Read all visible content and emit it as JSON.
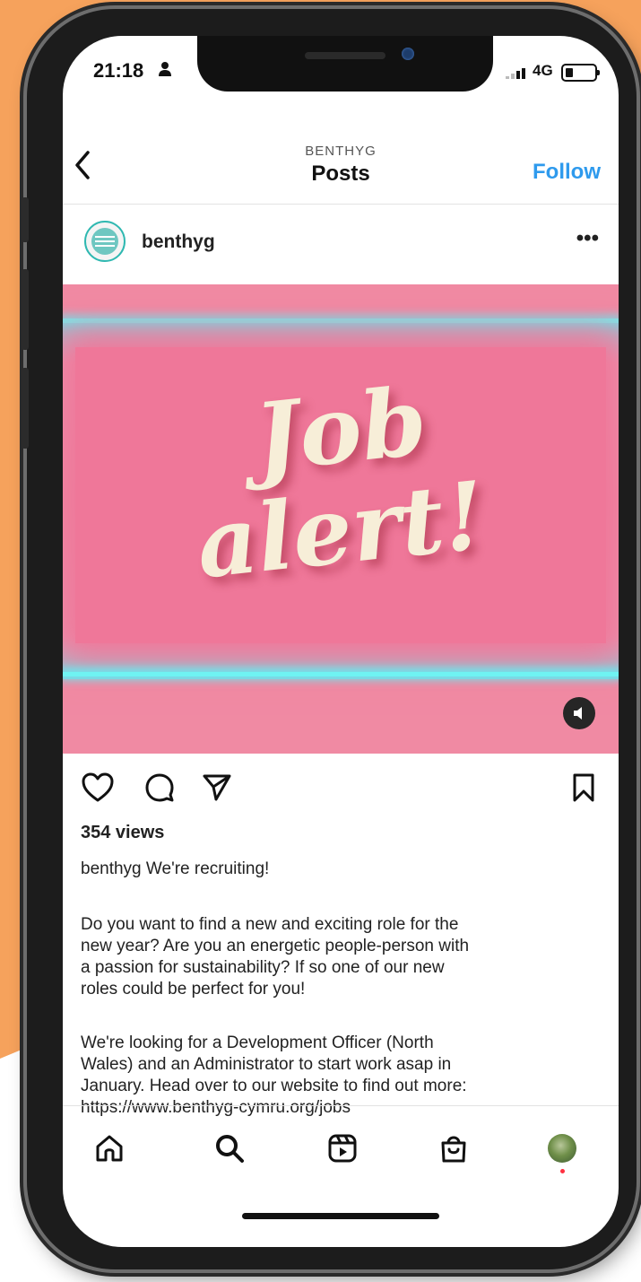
{
  "status_bar": {
    "time": "21:18",
    "network": "4G"
  },
  "header": {
    "account_caps": "BENTHYG",
    "title": "Posts",
    "follow_label": "Follow"
  },
  "post": {
    "username": "benthyg",
    "media_text_line1": "Job",
    "media_text_line2": "alert!",
    "views": "354 views",
    "caption_user": "benthyg",
    "caption_text": "We're recruiting!",
    "paragraph1": "Do you want to find a new and exciting role for the\nnew year? Are you an energetic people-person with\na passion for sustainability?  If so one of our new\nroles could be perfect for you!",
    "paragraph2": "We're looking for a Development Officer (North\nWales) and an Administrator to start work asap in\nJanuary.  Head over to our website to find out more:\nhttps://www.benthyg-cymru.org/jobs"
  },
  "colors": {
    "background": "#f6a25c",
    "follow": "#2e9aed",
    "media_pink": "#ef7799",
    "neon": "#6ff3f2",
    "text_cream": "#f7eed8"
  },
  "icons": {
    "back": "chevron-left-icon",
    "more": "more-horizontal-icon",
    "like": "heart-icon",
    "comment": "comment-icon",
    "share": "send-icon",
    "save": "bookmark-icon",
    "sound": "speaker-icon",
    "nav": [
      "home-icon",
      "search-icon",
      "reels-icon",
      "shop-icon",
      "profile-avatar"
    ]
  }
}
